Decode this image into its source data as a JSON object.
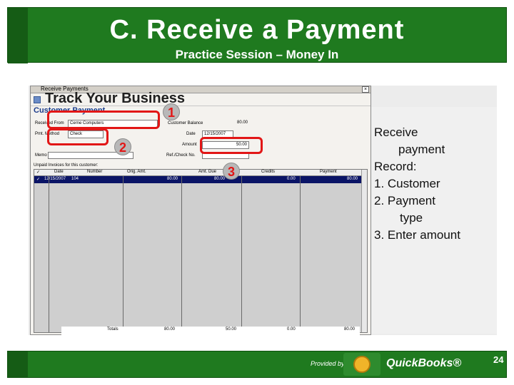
{
  "banner": {
    "title": "C. Receive a Payment",
    "subtitle": "Practice Session – Money In",
    "color": "#1f7a1f"
  },
  "window": {
    "title": "Receive Payments",
    "overlay_title": "Track Your Business",
    "form_header": "Customer Payment",
    "labels": {
      "received_from": "Received From",
      "pmt_method": "Pmt. Method",
      "memo": "Memo",
      "customer_balance": "Customer Balance",
      "date": "Date",
      "amount": "Amount",
      "ref_check_no": "Ref./Check No."
    },
    "values": {
      "customer": "Cerne Computers",
      "pmt_method": "Check",
      "customer_balance": "80.00",
      "date": "12/15/2007",
      "amount": "50.00"
    },
    "invoices_label": "Unpaid Invoices for this customer:",
    "columns": [
      "✓",
      "Date",
      "Number",
      "Orig. Amt.",
      "Amt. Due",
      "Credits",
      "Payment"
    ],
    "row": {
      "check": "✓",
      "date": "12/15/2007",
      "number": "104",
      "orig_amt": "80.00",
      "amt_due": "80.00",
      "credits": "0.00",
      "payment": "80.00"
    },
    "totals": {
      "label": "Totals",
      "orig_amt": "80.00",
      "amt_due": "50.00",
      "credits": "0.00",
      "payment": "80.00"
    }
  },
  "callouts": [
    "1",
    "2",
    "3"
  ],
  "notes": {
    "line1": "Receive",
    "line2": "payment",
    "line3": "Record:",
    "line4": "1. Customer",
    "line5": "2. Payment",
    "line6": "type",
    "line7": "3. Enter amount"
  },
  "footer": {
    "provided_by": "Provided by",
    "logo_text": "QuickBooks®",
    "page_number": "24"
  }
}
